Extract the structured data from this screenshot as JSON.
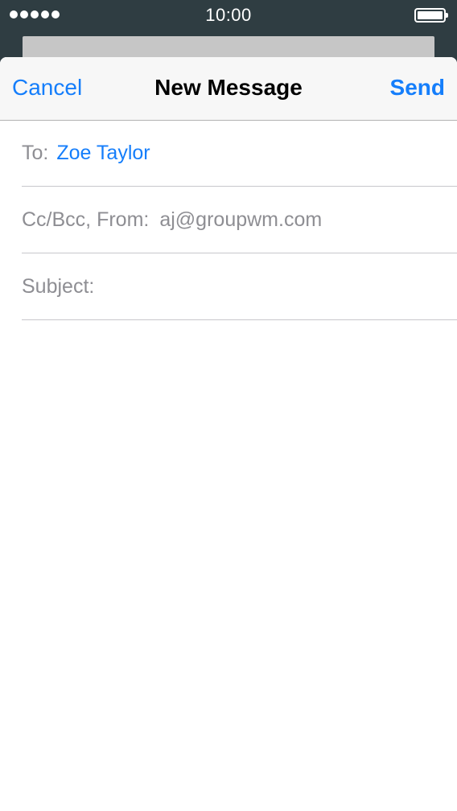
{
  "status_bar": {
    "signal_dots": 5,
    "time": "10:00",
    "battery_level": 1.0
  },
  "nav": {
    "cancel_label": "Cancel",
    "title": "New Message",
    "send_label": "Send"
  },
  "fields": {
    "to_label": "To:",
    "to_value": "Zoe Taylor",
    "cc_label": "Cc/Bcc, From:",
    "cc_value": "aj@groupwm.com",
    "subject_label": "Subject:",
    "subject_value": ""
  },
  "colors": {
    "accent": "#157efb",
    "status_bar_bg": "#2f3d42",
    "secondary_text": "#8e8e93"
  }
}
